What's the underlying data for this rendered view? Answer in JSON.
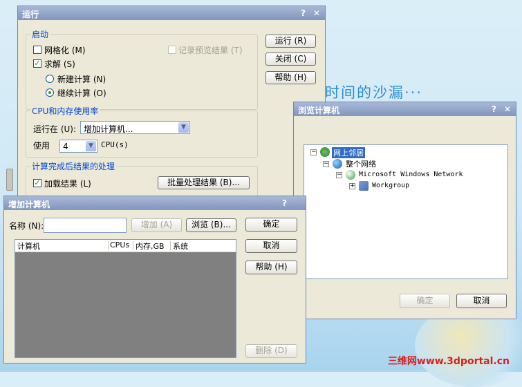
{
  "desktop": {
    "decor_text": "时间的沙漏···",
    "watermark": "三维网www.3dportal.cn"
  },
  "run_dialog": {
    "title": "运行",
    "help_glyph": "?",
    "close_glyph": "✕",
    "startup_group": "启动",
    "mesh_label": "网格化 (M)",
    "mesh_checked": false,
    "record_label": "记录预览结果 (T)",
    "record_checked": false,
    "solve_label": "求解 (S)",
    "solve_checked": true,
    "new_calc_label": "新建计算 (N)",
    "continue_calc_label": "继续计算 (O)",
    "selected_calc": "continue",
    "cpu_group": "CPU和内存使用率",
    "run_on_label": "运行在 (U):",
    "run_on_value": "增加计算机...",
    "use_label": "使用",
    "cpu_count": "4",
    "cpu_unit": "CPU(s)",
    "post_group": "计算完成后结果的处理",
    "load_results_label": "加载结果 (L)",
    "load_results_checked": true,
    "batch_button": "批量处理结果 (B)...",
    "run_button": "运行 (R)",
    "close_button": "关闭 (C)",
    "help_button": "帮助 (H)"
  },
  "add_dialog": {
    "title": "增加计算机",
    "help_glyph": "?",
    "name_label": "名称 (N):",
    "name_value": "",
    "add_button": "增加 (A)",
    "browse_button": "浏览 (B)...",
    "ok_button": "确定",
    "cancel_button": "取消",
    "help_button": "帮助 (H)",
    "delete_button": "删除 (D)",
    "columns": [
      "计算机",
      "CPUs",
      "内存,GB",
      "系统"
    ]
  },
  "browse_dialog": {
    "title": "浏览计算机",
    "help_glyph": "?",
    "close_glyph": "✕",
    "tree": [
      {
        "label": "网上邻居",
        "expander": "−",
        "icon": "network-neighborhood-icon",
        "selected": true
      },
      {
        "label": "整个网络",
        "expander": "−",
        "icon": "entire-network-icon",
        "selected": false
      },
      {
        "label": "Microsoft Windows Network",
        "expander": "−",
        "icon": "windows-network-icon",
        "selected": false
      },
      {
        "label": "Workgroup",
        "expander": "+",
        "icon": "workgroup-icon",
        "selected": false
      }
    ],
    "ok_button": "确定",
    "cancel_button": "取消"
  },
  "colors": {
    "title_gradient_top": "#a8b8d8",
    "title_gradient_bottom": "#8296bc",
    "dialog_bg": "#ece9d8",
    "group_label": "#0046d5",
    "check_green": "#21a121",
    "selection": "#316ac5"
  }
}
